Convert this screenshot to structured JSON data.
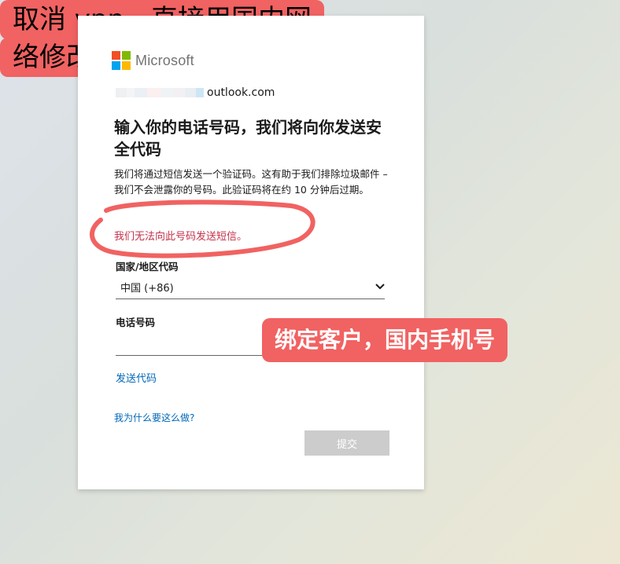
{
  "brand": {
    "name": "Microsoft",
    "colors": [
      "#f25022",
      "#7fba00",
      "#00a4ef",
      "#ffb900"
    ]
  },
  "account": {
    "domain_suffix": "outlook.com"
  },
  "title": "输入你的电话号码，我们将向你发送安全代码",
  "description": "我们将通过短信发送一个验证码。这有助于我们排除垃圾邮件 – 我们不会泄露你的号码。此验证码将在约 10 分钟后过期。",
  "error_message": "我们无法向此号码发送短信。",
  "country": {
    "label": "国家/地区代码",
    "selected": "中国 (+86)"
  },
  "phone": {
    "label": "电话号码",
    "value": ""
  },
  "send_code_link": "发送代码",
  "why_link": "我为什么要这么做?",
  "submit_label": "提交",
  "annotations": {
    "callout_1": "绑定客户，国内手机号",
    "callout_2_line_1": "取消 vpn，直接用国内网",
    "callout_2_line_2": "络修改邮箱密码",
    "color": "#f16262"
  }
}
